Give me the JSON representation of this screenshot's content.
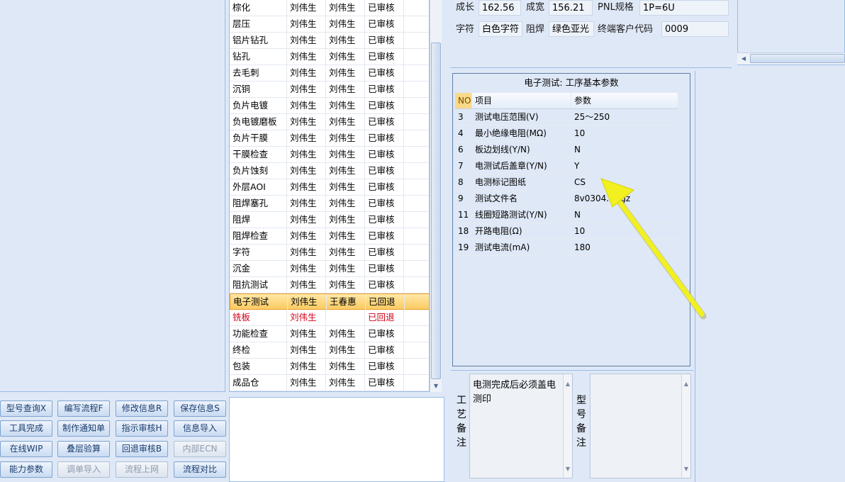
{
  "process_rows": [
    {
      "name": "棕化",
      "maker": "刘伟生",
      "checker": "刘伟生",
      "status": "已审核"
    },
    {
      "name": "层压",
      "maker": "刘伟生",
      "checker": "刘伟生",
      "status": "已审核"
    },
    {
      "name": "铝片钻孔",
      "maker": "刘伟生",
      "checker": "刘伟生",
      "status": "已审核"
    },
    {
      "name": "钻孔",
      "maker": "刘伟生",
      "checker": "刘伟生",
      "status": "已审核"
    },
    {
      "name": "去毛刺",
      "maker": "刘伟生",
      "checker": "刘伟生",
      "status": "已审核"
    },
    {
      "name": "沉铜",
      "maker": "刘伟生",
      "checker": "刘伟生",
      "status": "已审核"
    },
    {
      "name": "负片电镀",
      "maker": "刘伟生",
      "checker": "刘伟生",
      "status": "已审核"
    },
    {
      "name": "负电镀磨板",
      "maker": "刘伟生",
      "checker": "刘伟生",
      "status": "已审核"
    },
    {
      "name": "负片干膜",
      "maker": "刘伟生",
      "checker": "刘伟生",
      "status": "已审核"
    },
    {
      "name": "干膜检查",
      "maker": "刘伟生",
      "checker": "刘伟生",
      "status": "已审核"
    },
    {
      "name": "负片蚀刻",
      "maker": "刘伟生",
      "checker": "刘伟生",
      "status": "已审核"
    },
    {
      "name": "外层AOI",
      "maker": "刘伟生",
      "checker": "刘伟生",
      "status": "已审核"
    },
    {
      "name": "阻焊塞孔",
      "maker": "刘伟生",
      "checker": "刘伟生",
      "status": "已审核"
    },
    {
      "name": "阻焊",
      "maker": "刘伟生",
      "checker": "刘伟生",
      "status": "已审核"
    },
    {
      "name": "阻焊检查",
      "maker": "刘伟生",
      "checker": "刘伟生",
      "status": "已审核"
    },
    {
      "name": "字符",
      "maker": "刘伟生",
      "checker": "刘伟生",
      "status": "已审核"
    },
    {
      "name": "沉金",
      "maker": "刘伟生",
      "checker": "刘伟生",
      "status": "已审核"
    },
    {
      "name": "阻抗测试",
      "maker": "刘伟生",
      "checker": "刘伟生",
      "status": "已审核"
    },
    {
      "name": "电子测试",
      "maker": "刘伟生",
      "checker": "王春惠",
      "status": "已回退"
    },
    {
      "name": "铣板",
      "maker": "刘伟生",
      "checker": "",
      "status": "已回退"
    },
    {
      "name": "功能检查",
      "maker": "刘伟生",
      "checker": "刘伟生",
      "status": "已审核"
    },
    {
      "name": "终检",
      "maker": "刘伟生",
      "checker": "刘伟生",
      "status": "已审核"
    },
    {
      "name": "包装",
      "maker": "刘伟生",
      "checker": "刘伟生",
      "status": "已审核"
    },
    {
      "name": "成品仓",
      "maker": "刘伟生",
      "checker": "刘伟生",
      "status": "已审核"
    }
  ],
  "buttons": {
    "model_query": "型号查询X",
    "edit_flow": "编写流程F",
    "modify_info": "修改信息R",
    "save_info": "保存信息S",
    "tool_done": "工具完成",
    "make_notice": "制作通知单",
    "instr_review": "指示审核H",
    "info_import": "信息导入",
    "online_wip": "在线WIP",
    "stack_check": "叠层验算",
    "rollback_review": "回退审核B",
    "internal_ecn": "内部ECN",
    "capability": "能力参数",
    "order_import": "调单导入",
    "flow_upload": "流程上网",
    "flow_compare": "流程对比"
  },
  "info": {
    "length_label": "成长",
    "length_value": "162.56",
    "width_label": "成宽",
    "width_value": "156.21",
    "pnl_label": "PNL规格",
    "pnl_value": "1P=6U",
    "char_label": "字符",
    "char_value": "白色字符",
    "mask_label": "阻焊",
    "mask_value": "绿色亚光",
    "cust_label": "终端客户代码",
    "cust_value": "0009"
  },
  "param_panel": {
    "title": "电子测试: 工序基本参数",
    "headers": {
      "no": "NO",
      "item": "项目",
      "param": "参数"
    },
    "rows": [
      {
        "no": "3",
        "item": "测试电压范围(V)",
        "param": "25～250"
      },
      {
        "no": "4",
        "item": "最小绝缘电阻(MΩ)",
        "param": "10"
      },
      {
        "no": "6",
        "item": "板边划线(Y/N)",
        "param": "N"
      },
      {
        "no": "7",
        "item": "电测试后盖章(Y/N)",
        "param": "Y"
      },
      {
        "no": "8",
        "item": "电测标记图纸",
        "param": "CS"
      },
      {
        "no": "9",
        "item": "测试文件名",
        "param": "8v0304.0.tgz"
      },
      {
        "no": "11",
        "item": "线圈短路测试(Y/N)",
        "param": "N"
      },
      {
        "no": "18",
        "item": "开路电阻(Ω)",
        "param": "10"
      },
      {
        "no": "19",
        "item": "测试电流(mA)",
        "param": "180"
      }
    ]
  },
  "remarks": {
    "process_label": "工艺备注",
    "process_text": "电测完成后必须盖电测印",
    "model_label": "型号备注",
    "model_text": ""
  },
  "colors": {
    "arrow": "#f2f020",
    "selected_row": "#fbcb62",
    "rolled_back": "#d0021b"
  }
}
